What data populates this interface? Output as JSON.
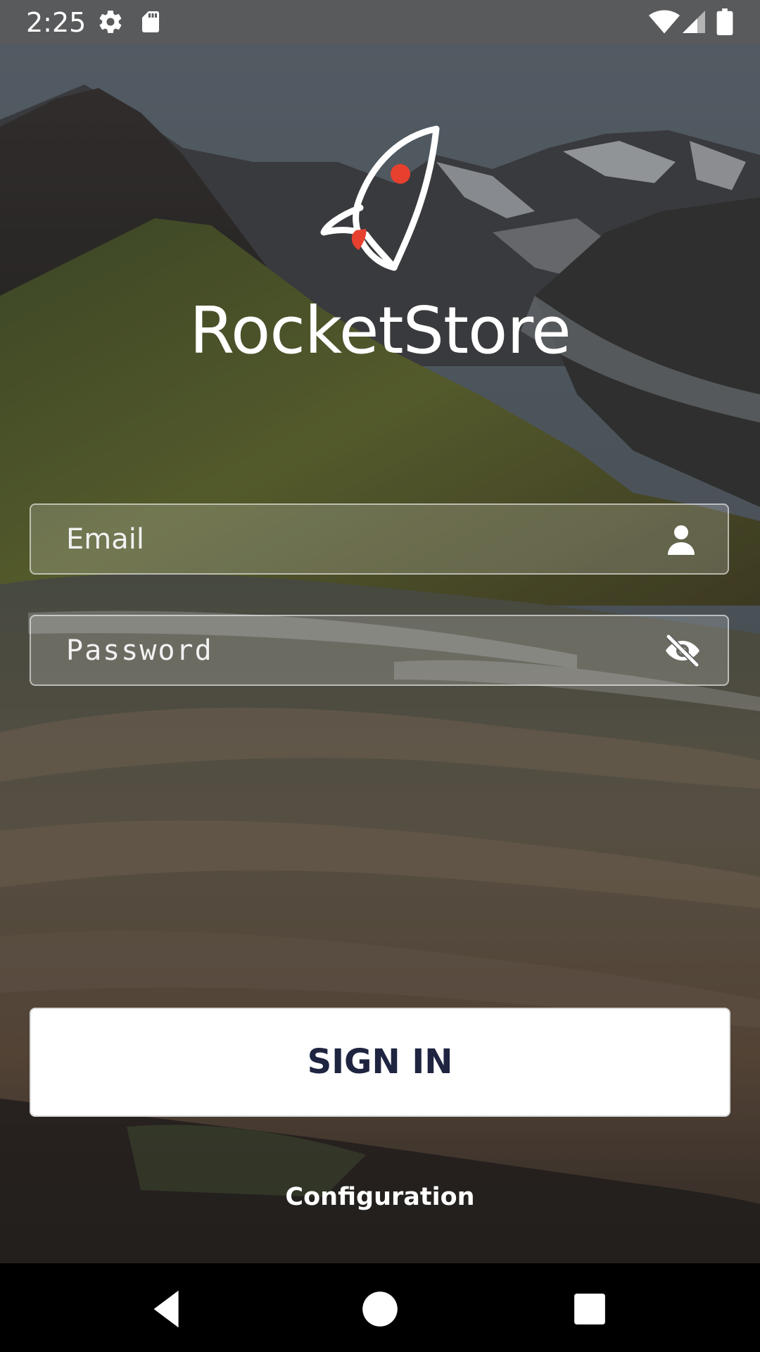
{
  "status_bar": {
    "time": "2:25",
    "icons": [
      "settings-icon",
      "sd-card-icon",
      "wifi-icon",
      "signal-icon",
      "battery-icon"
    ]
  },
  "app": {
    "title": "RocketStore",
    "logo": "rocket-icon",
    "accent_color": "#e8402f"
  },
  "login": {
    "email_placeholder": "Email",
    "email_value": "",
    "email_icon": "person-icon",
    "password_placeholder": "Password",
    "password_value": "",
    "password_icon": "eye-off-icon",
    "sign_in_label": "SIGN IN",
    "configuration_label": "Configuration"
  },
  "nav_bar": {
    "buttons": [
      "back-icon",
      "home-icon",
      "recents-icon"
    ]
  },
  "colors": {
    "button_text": "#1f2440",
    "button_bg": "#ffffff",
    "nav_bar": "#000000"
  }
}
